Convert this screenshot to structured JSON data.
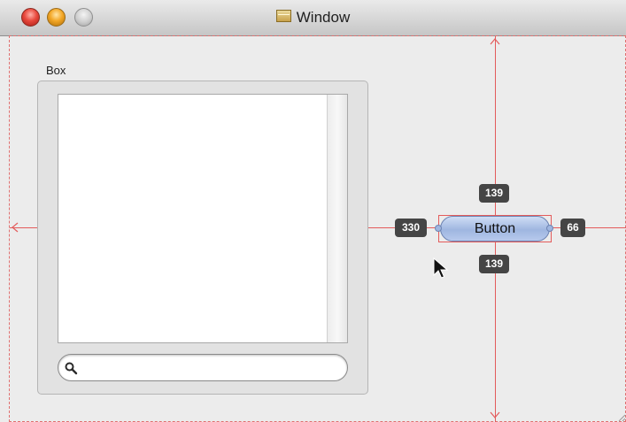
{
  "window": {
    "title": "Window"
  },
  "box": {
    "label": "Box"
  },
  "search": {
    "placeholder": "",
    "value": ""
  },
  "button": {
    "label": "Button"
  },
  "guides": {
    "top_distance": "139",
    "bottom_distance": "139",
    "left_distance": "330",
    "right_distance": "66"
  },
  "colors": {
    "guide": "#e35b5b",
    "button_fill": "#9fb6e0",
    "badge": "#454545",
    "close": "#e8483c",
    "minimize": "#f3a726"
  },
  "icons": [
    "close-icon",
    "minimize-icon",
    "zoom-icon",
    "window-icon",
    "search-icon",
    "mouse-pointer-icon"
  ]
}
